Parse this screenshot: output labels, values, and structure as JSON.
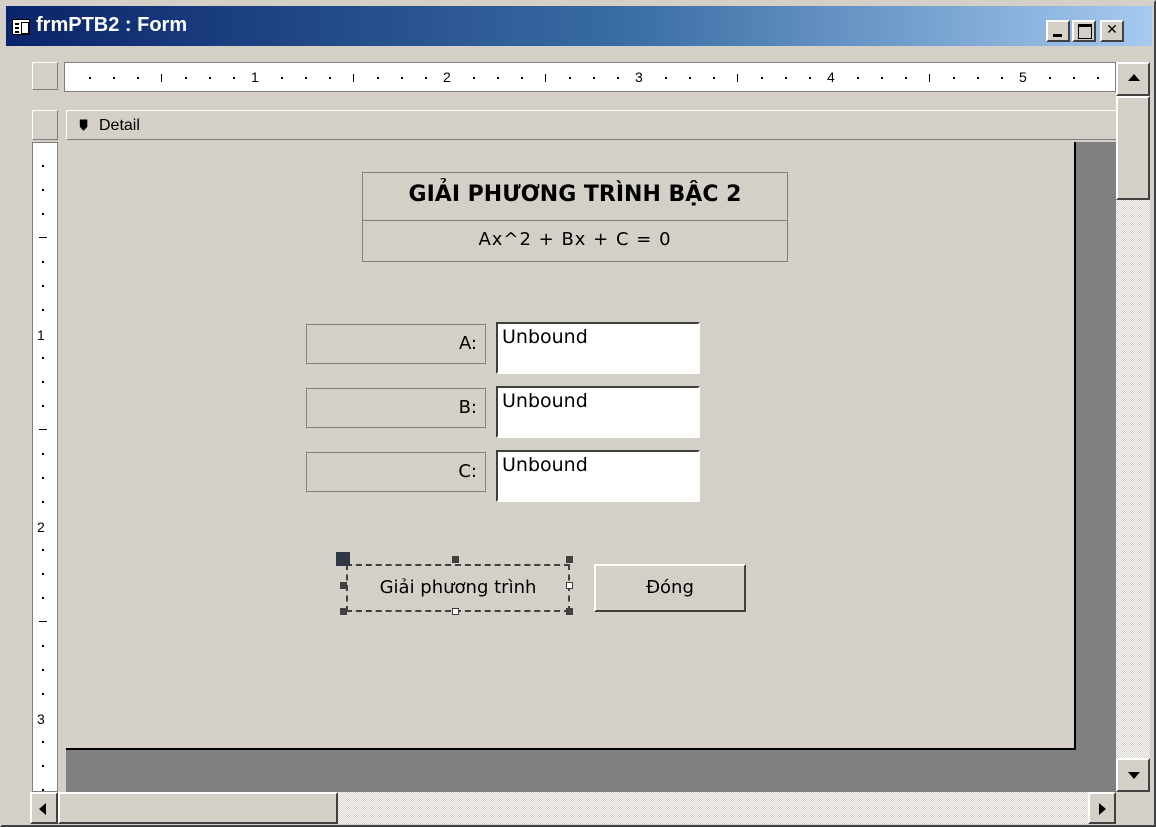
{
  "window": {
    "title": "frmPTB2 : Form",
    "icon": "form-icon",
    "controls": [
      "minimize",
      "maximize",
      "close"
    ]
  },
  "ruler": {
    "horizontal_numbers": [
      "1",
      "2",
      "3",
      "4",
      "5"
    ],
    "vertical_numbers": [
      "1",
      "2",
      "3"
    ]
  },
  "section": {
    "label": "Detail",
    "icon": "section-selector-icon"
  },
  "form": {
    "title": "GIẢI PHƯƠNG TRÌNH BẬC 2",
    "subtitle": "Ax^2 + Bx + C = 0",
    "fields": [
      {
        "label": "A:",
        "value": "Unbound"
      },
      {
        "label": "B:",
        "value": "Unbound"
      },
      {
        "label": "C:",
        "value": "Unbound"
      }
    ],
    "buttons": {
      "solve": "Giải phương trình",
      "close": "Đóng"
    }
  },
  "colors": {
    "title_gradient_start": "#0a246a",
    "title_gradient_end": "#a6caf0",
    "form_background": "#d4d0c8",
    "workspace": "#808080"
  }
}
